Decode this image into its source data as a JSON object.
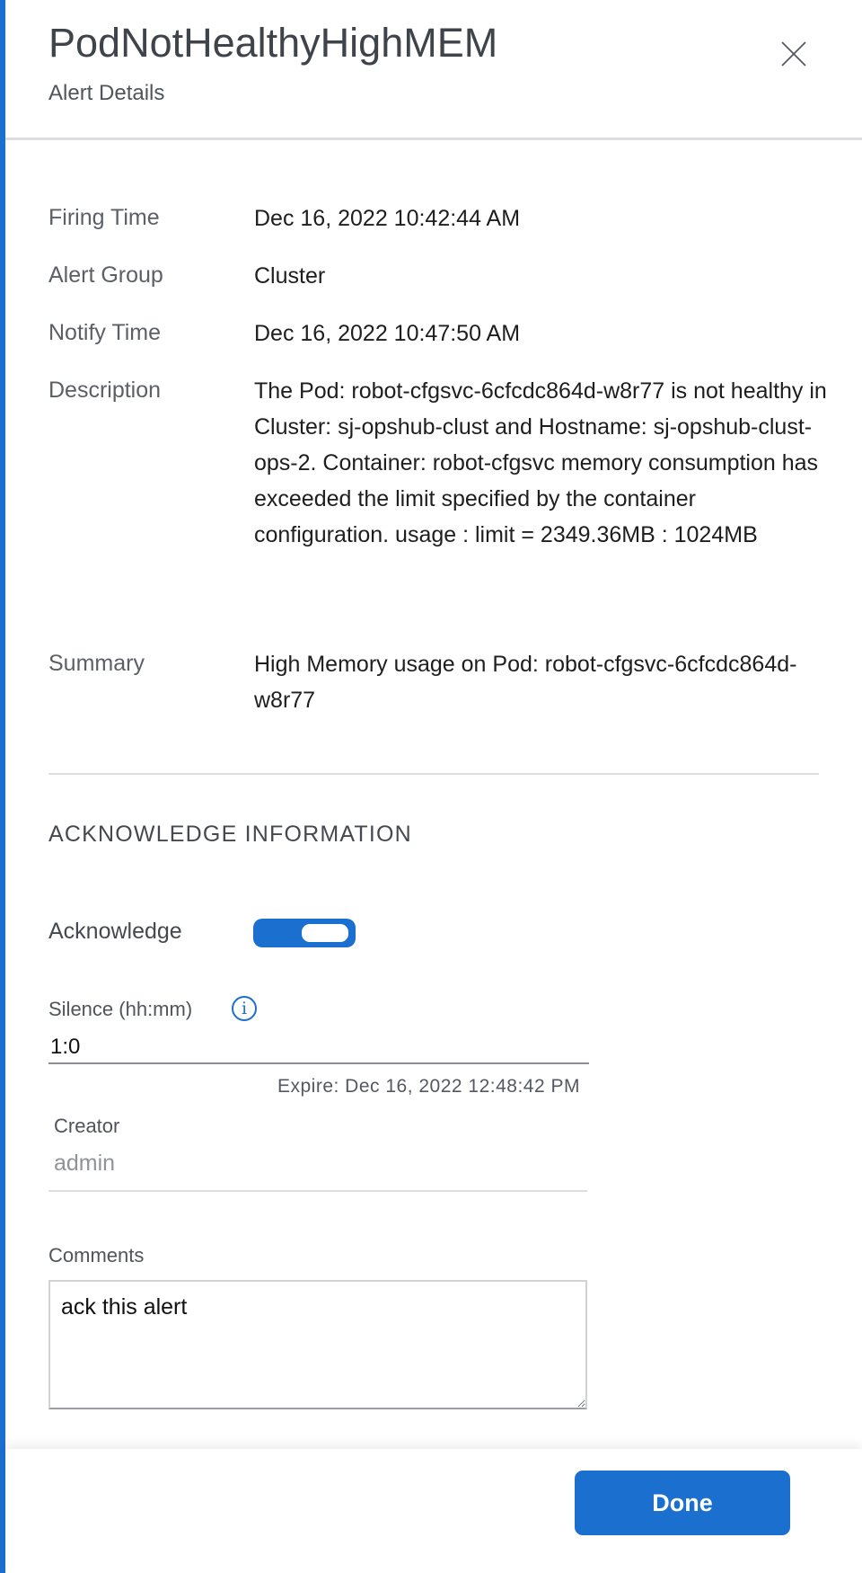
{
  "header": {
    "title": "PodNotHealthyHighMEM",
    "subtitle": "Alert Details",
    "close_icon": "close-icon"
  },
  "details": [
    {
      "label": "Firing Time",
      "value": "Dec 16, 2022 10:42:44 AM"
    },
    {
      "label": "Alert Group",
      "value": "Cluster"
    },
    {
      "label": "Notify Time",
      "value": "Dec 16, 2022 10:47:50 AM"
    },
    {
      "label": "Description",
      "value": "The Pod: robot-cfgsvc-6cfcdc864d-w8r77 is not healthy in Cluster: sj-opshub-clust and Hostname: sj-opshub-clust-ops-2. Container: robot-cfgsvc memory consumption has exceeded the limit specified by the container configuration. usage : limit = 2349.36MB : 1024MB"
    },
    {
      "label": "Summary",
      "value": "High Memory usage on Pod: robot-cfgsvc-6cfcdc864d-w8r77"
    }
  ],
  "ack": {
    "section_title": "ACKNOWLEDGE INFORMATION",
    "acknowledge_label": "Acknowledge",
    "acknowledge_on": true,
    "silence_label": "Silence (hh:mm)",
    "info_glyph": "i",
    "silence_value": "1:0",
    "expire": "Expire: Dec 16, 2022 12:48:42 PM",
    "creator_label": "Creator",
    "creator_value": "admin",
    "comments_label": "Comments",
    "comments_value": "ack this alert"
  },
  "footer": {
    "done_label": "Done"
  },
  "colors": {
    "accent": "#1b6fcf"
  }
}
